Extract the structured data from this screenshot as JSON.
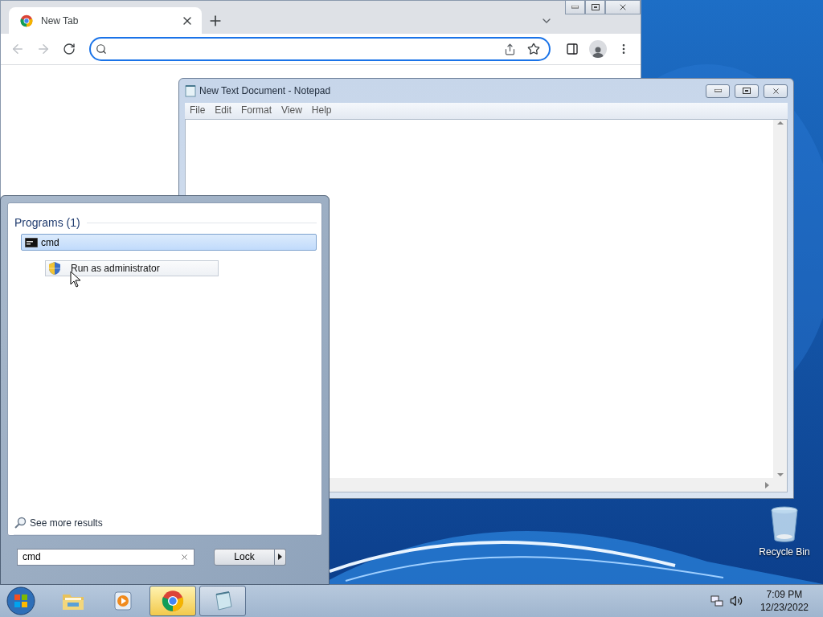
{
  "chrome": {
    "tabs": [
      {
        "title": "New Tab",
        "selected": true
      }
    ]
  },
  "notepad": {
    "title": "New Text Document - Notepad",
    "menu": [
      "File",
      "Edit",
      "Format",
      "View",
      "Help"
    ]
  },
  "start_menu": {
    "section": "Programs (1)",
    "results": [
      {
        "label": "cmd",
        "selected": true
      }
    ],
    "jump_item": "Run as administrator",
    "see_more": "See more results",
    "search": {
      "value": "cmd"
    },
    "power_button": "Lock"
  },
  "desktop_icons": [
    {
      "label": "Recycle Bin"
    }
  ],
  "taskbar": {
    "apps": [
      {
        "kind": "explorer",
        "selected": false,
        "open": false
      },
      {
        "kind": "media",
        "selected": false,
        "open": false
      },
      {
        "kind": "chrome",
        "selected": true,
        "open": true
      },
      {
        "kind": "notepad",
        "selected": false,
        "open": true
      }
    ],
    "clock": {
      "time": "7:09 PM",
      "date": "12/23/2022"
    }
  }
}
